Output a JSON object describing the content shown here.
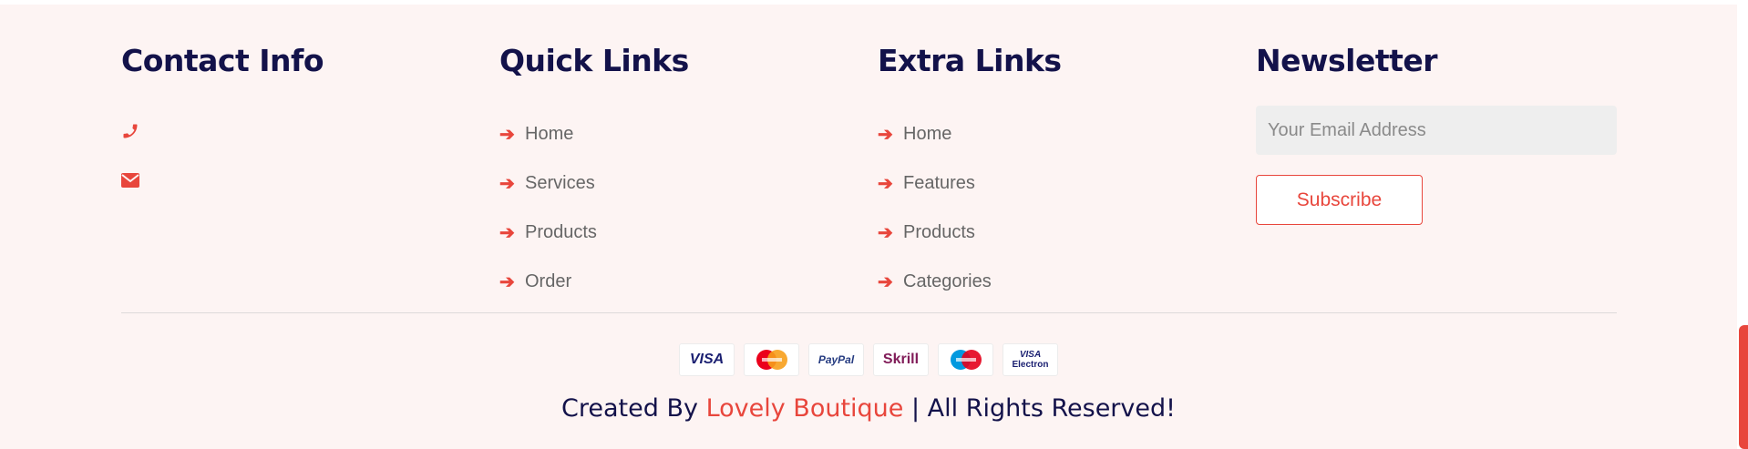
{
  "contact": {
    "title": "Contact Info",
    "phone_icon": "phone-icon",
    "email_icon": "envelope-icon"
  },
  "quick_links": {
    "title": "Quick Links",
    "items": [
      "Home",
      "Services",
      "Products",
      "Order"
    ]
  },
  "extra_links": {
    "title": "Extra Links",
    "items": [
      "Home",
      "Features",
      "Products",
      "Categories"
    ]
  },
  "newsletter": {
    "title": "Newsletter",
    "email_placeholder": "Your Email Address",
    "subscribe_label": "Subscribe"
  },
  "payment_cards": {
    "visa": "VISA",
    "paypal": "PayPal",
    "skrill": "Skrill",
    "visa_electron_top": "VISA",
    "visa_electron_bottom": "Electron"
  },
  "credits": {
    "prefix": "Created By ",
    "brand": "Lovely Boutique",
    "suffix": " | All Rights Reserved!"
  },
  "colors": {
    "accent": "#e8463c",
    "heading": "#13124a",
    "background": "#fdf4f3"
  }
}
